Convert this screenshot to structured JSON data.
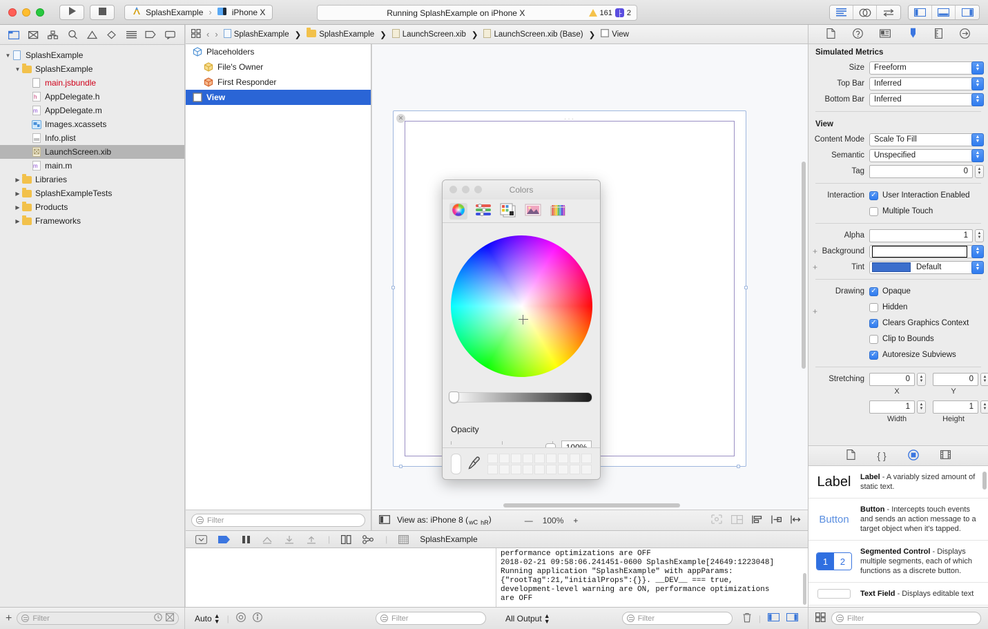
{
  "titlebar": {
    "run_tooltip": "Run",
    "stop_tooltip": "Stop",
    "scheme_name": "SplashExample",
    "scheme_sep": "›",
    "destination": "iPhone X",
    "status_text": "Running SplashExample on iPhone X",
    "warning_count": "161",
    "issue_count": "2"
  },
  "navigator": {
    "toolbar_icons": [
      "folder-icon",
      "source-control-icon",
      "symbol-icon",
      "search-icon",
      "warning-icon",
      "test-icon",
      "debug-icon",
      "breakpoint-icon",
      "report-icon"
    ],
    "tree": [
      {
        "label": "SplashExample",
        "depth": 0,
        "icon": "project-icon",
        "twisty": "open",
        "selected": false,
        "color": "normal"
      },
      {
        "label": "SplashExample",
        "depth": 1,
        "icon": "folder-icon",
        "twisty": "open",
        "selected": false,
        "color": "normal"
      },
      {
        "label": "main.jsbundle",
        "depth": 2,
        "icon": "file-icon",
        "twisty": "none",
        "selected": false,
        "color": "red"
      },
      {
        "label": "AppDelegate.h",
        "depth": 2,
        "icon": "header-icon",
        "twisty": "none",
        "selected": false,
        "color": "normal"
      },
      {
        "label": "AppDelegate.m",
        "depth": 2,
        "icon": "objc-icon",
        "twisty": "none",
        "selected": false,
        "color": "normal"
      },
      {
        "label": "Images.xcassets",
        "depth": 2,
        "icon": "assets-icon",
        "twisty": "none",
        "selected": false,
        "color": "normal"
      },
      {
        "label": "Info.plist",
        "depth": 2,
        "icon": "plist-icon",
        "twisty": "none",
        "selected": false,
        "color": "normal"
      },
      {
        "label": "LaunchScreen.xib",
        "depth": 2,
        "icon": "xib-icon",
        "twisty": "none",
        "selected": true,
        "color": "normal"
      },
      {
        "label": "main.m",
        "depth": 2,
        "icon": "objc-icon",
        "twisty": "none",
        "selected": false,
        "color": "normal"
      },
      {
        "label": "Libraries",
        "depth": 1,
        "icon": "folder-icon",
        "twisty": "closed",
        "selected": false,
        "color": "normal"
      },
      {
        "label": "SplashExampleTests",
        "depth": 1,
        "icon": "folder-icon",
        "twisty": "closed",
        "selected": false,
        "color": "normal"
      },
      {
        "label": "Products",
        "depth": 1,
        "icon": "folder-icon",
        "twisty": "closed",
        "selected": false,
        "color": "normal"
      },
      {
        "label": "Frameworks",
        "depth": 1,
        "icon": "folder-icon",
        "twisty": "closed",
        "selected": false,
        "color": "normal"
      }
    ],
    "filter_placeholder": "Filter"
  },
  "editor_bar": {
    "breadcrumbs": [
      "SplashExample",
      "SplashExample",
      "LaunchScreen.xib",
      "LaunchScreen.xib (Base)",
      "View"
    ],
    "back_label": "‹",
    "forward_label": "›"
  },
  "outline": {
    "items": [
      {
        "label": "Placeholders",
        "icon": "cube-blue-icon",
        "indent": false,
        "selected": false
      },
      {
        "label": "File's Owner",
        "icon": "cube-yellow-icon",
        "indent": true,
        "selected": false
      },
      {
        "label": "First Responder",
        "icon": "cube-orange-icon",
        "indent": true,
        "selected": false
      },
      {
        "label": "View",
        "icon": "view-square-icon",
        "indent": false,
        "selected": true
      }
    ],
    "filter_placeholder": "Filter"
  },
  "colors_panel": {
    "title": "Colors",
    "modes": [
      "color-wheel-icon",
      "color-sliders-icon",
      "color-palettes-icon",
      "image-palettes-icon",
      "crayons-icon"
    ],
    "active_mode_index": 0,
    "opacity_label": "Opacity",
    "opacity_value": "100%",
    "selected_swatch": "#ffffff",
    "eyedropper": "eyedropper-icon"
  },
  "canvas_bottom": {
    "view_as_label": "View as: iPhone 8 (",
    "view_as_wc": "wC",
    "view_as_hr": "hR",
    "view_as_close": ")",
    "zoom_out": "—",
    "zoom_value": "100%",
    "zoom_in": "+",
    "icons": [
      "update-frames-icon",
      "embed-in-icon",
      "align-icon",
      "pin-icon",
      "resolve-issues-icon"
    ]
  },
  "debug_bar": {
    "icons": [
      "hide-debug-icon",
      "continue-icon",
      "pause-icon",
      "step-over-icon",
      "step-into-icon",
      "step-out-icon",
      "view-hierarchy-icon",
      "memory-graph-icon"
    ],
    "process_label": "SplashExample"
  },
  "console": {
    "text": "performance optimizations are OFF\n2018-02-21 09:58:06.241451-0600 SplashExample[24649:1223048]\nRunning application \"SplashExample\" with appParams:\n{\"rootTag\":21,\"initialProps\":{}}. __DEV__ === true,\ndevelopment-level warning are ON, performance optimizations\nare OFF"
  },
  "bottom_bar": {
    "add_label": "+",
    "nav_filter_placeholder": "Filter",
    "auto_label": "Auto",
    "var_filter_placeholder": "Filter",
    "output_label": "All Output",
    "console_filter_placeholder": "Filter",
    "library_filter_placeholder": "Filter"
  },
  "inspector": {
    "tabs": [
      "file-inspector-icon",
      "quick-help-icon",
      "identity-inspector-icon",
      "attributes-inspector-icon",
      "size-inspector-icon",
      "connections-inspector-icon"
    ],
    "active_tab_index": 3,
    "sections": [
      {
        "title": "Simulated Metrics",
        "rows": [
          {
            "type": "popup",
            "label": "Size",
            "value": "Freeform"
          },
          {
            "type": "popup",
            "label": "Top Bar",
            "value": "Inferred"
          },
          {
            "type": "popup",
            "label": "Bottom Bar",
            "value": "Inferred"
          }
        ]
      },
      {
        "title": "View",
        "rows": [
          {
            "type": "popup",
            "label": "Content Mode",
            "value": "Scale To Fill"
          },
          {
            "type": "popup",
            "label": "Semantic",
            "value": "Unspecified"
          },
          {
            "type": "number",
            "label": "Tag",
            "value": "0"
          },
          {
            "type": "checkbox",
            "label": "Interaction",
            "text": "User Interaction Enabled",
            "checked": true
          },
          {
            "type": "checkbox",
            "label": "",
            "text": "Multiple Touch",
            "checked": false
          },
          {
            "type": "number",
            "label": "Alpha",
            "value": "1"
          },
          {
            "type": "color",
            "label": "Background",
            "value": ""
          },
          {
            "type": "tint",
            "label": "Tint",
            "value": "Default"
          },
          {
            "type": "checkbox",
            "label": "Drawing",
            "text": "Opaque",
            "checked": true
          },
          {
            "type": "checkbox",
            "label": "",
            "text": "Hidden",
            "checked": false
          },
          {
            "type": "checkbox",
            "label": "",
            "text": "Clears Graphics Context",
            "checked": true
          },
          {
            "type": "checkbox",
            "label": "",
            "text": "Clip to Bounds",
            "checked": false
          },
          {
            "type": "checkbox",
            "label": "",
            "text": "Autoresize Subviews",
            "checked": true
          }
        ]
      }
    ],
    "stretching": {
      "label": "Stretching",
      "x_value": "0",
      "x_label": "X",
      "y_value": "0",
      "y_label": "Y",
      "w_value": "1",
      "w_label": "Width",
      "h_value": "1",
      "h_label": "Height"
    }
  },
  "library": {
    "tabs": [
      "file-template-icon",
      "code-snippet-icon",
      "object-library-icon",
      "media-library-icon"
    ],
    "active_tab_index": 2,
    "items": [
      {
        "thumb": "label-thumb",
        "thumb_text": "Label",
        "name": "Label",
        "desc": " - A variably sized amount of static text."
      },
      {
        "thumb": "button-thumb",
        "thumb_text": "Button",
        "name": "Button",
        "desc": " - Intercepts touch events and sends an action message to a target object when it's tapped."
      },
      {
        "thumb": "segmented-thumb",
        "thumb_text": "1 2",
        "name": "Segmented Control",
        "desc": " - Displays multiple segments, each of which functions as a discrete button."
      },
      {
        "thumb": "textfield-thumb",
        "thumb_text": "",
        "name": "Text Field",
        "desc": " - Displays editable text"
      }
    ]
  }
}
